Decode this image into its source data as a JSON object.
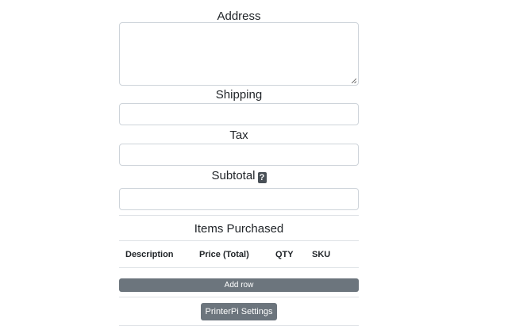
{
  "fields": {
    "address_label": "Address",
    "address_value": "",
    "shipping_label": "Shipping",
    "shipping_value": "",
    "tax_label": "Tax",
    "tax_value": "",
    "subtotal_label": "Subtotal",
    "subtotal_help": "?",
    "subtotal_value": ""
  },
  "items": {
    "title": "Items Purchased",
    "columns": [
      "Description",
      "Price (Total)",
      "QTY",
      "SKU"
    ],
    "add_row_label": "Add row"
  },
  "footer": {
    "settings_label": "PrinterPi Settings"
  },
  "colors": {
    "button_bg": "#6c757d",
    "border": "#ced4da",
    "divider": "#dee2e6"
  }
}
